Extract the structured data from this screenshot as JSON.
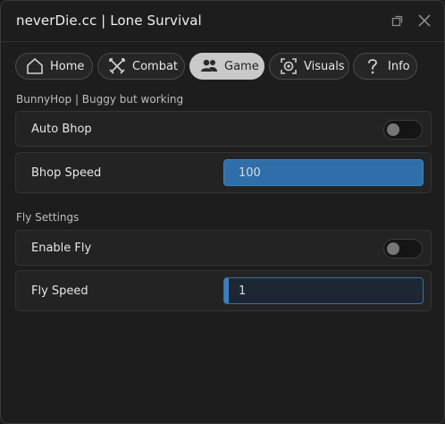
{
  "window": {
    "title": "neverDie.cc | Lone Survival",
    "restore_icon": "restore-icon",
    "close_icon": "close-icon"
  },
  "tabs": [
    {
      "label": "Home",
      "icon": "home-icon",
      "active": false
    },
    {
      "label": "Combat",
      "icon": "crossed-swords-icon",
      "active": false
    },
    {
      "label": "Game",
      "icon": "users-icon",
      "active": true
    },
    {
      "label": "Visuals",
      "icon": "target-icon",
      "active": false
    },
    {
      "label": "Info",
      "icon": "question-icon",
      "active": false
    }
  ],
  "sections": {
    "bunnyhop": {
      "title": "BunnyHop | Buggy but working",
      "auto_bhop": {
        "label": "Auto Bhop",
        "enabled": false
      },
      "bhop_speed": {
        "label": "Bhop Speed",
        "value": "100",
        "fraction": 1.0
      }
    },
    "fly": {
      "title": "Fly Settings",
      "enable_fly": {
        "label": "Enable Fly",
        "enabled": false
      },
      "fly_speed": {
        "label": "Fly Speed",
        "value": "1",
        "fraction": 0.01
      }
    }
  },
  "colors": {
    "accent": "#2f6ea8",
    "background": "#1d1d1d",
    "active_tab": "#c9c9c9"
  }
}
